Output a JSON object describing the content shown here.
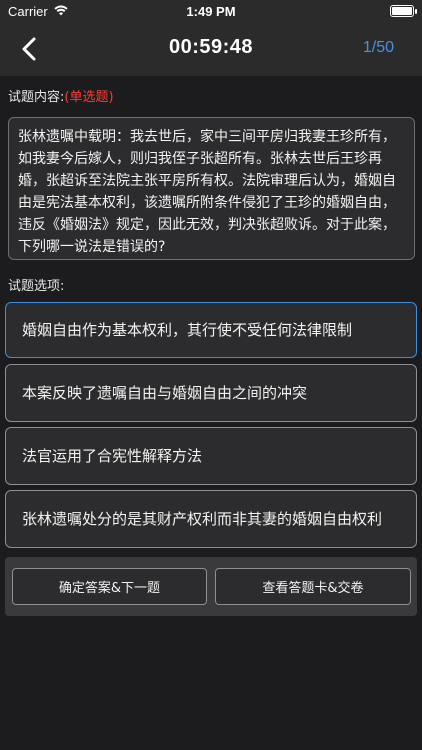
{
  "status_bar": {
    "carrier": "Carrier",
    "time": "1:49 PM"
  },
  "nav": {
    "timer": "00:59:48",
    "counter": "1/50"
  },
  "question": {
    "label": "试题内容:",
    "type": "(单选题)",
    "text": "张林遗嘱中载明：我去世后，家中三间平房归我妻王珍所有，如我妻今后嫁人，则归我侄子张超所有。张林去世后王珍再婚，张超诉至法院主张平房所有权。法院审理后认为，婚姻自由是宪法基本权利，该遗嘱所附条件侵犯了王珍的婚姻自由，违反《婚姻法》规定，因此无效，判决张超败诉。对于此案，下列哪一说法是错误的?"
  },
  "options": {
    "label": "试题选项:",
    "items": [
      "婚姻自由作为基本权利，其行使不受任何法律限制",
      "本案反映了遗嘱自由与婚姻自由之间的冲突",
      "法官运用了合宪性解释方法",
      "张林遗嘱处分的是其财产权利而非其妻的婚姻自由权利"
    ]
  },
  "actions": {
    "confirm": "确定答案&下一题",
    "answer_card": "查看答题卡&交卷"
  },
  "colors": {
    "accent": "#3f8be0",
    "question_type": "#ff3b30",
    "background": "#1c1c1e"
  }
}
